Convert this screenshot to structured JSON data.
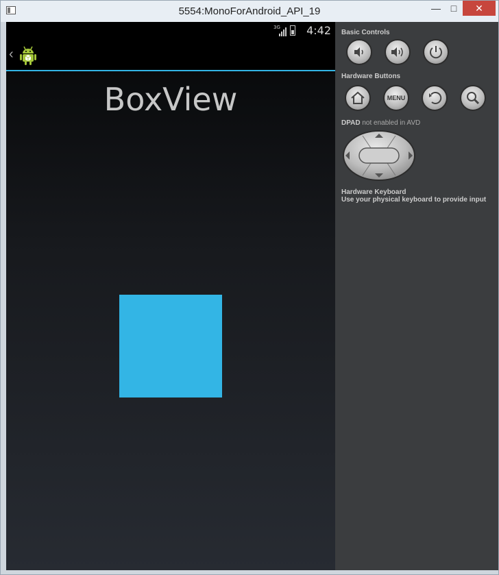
{
  "window": {
    "title": "5554:MonoForAndroid_API_19",
    "controls": [
      "minimize",
      "maximize",
      "close"
    ]
  },
  "status_bar": {
    "network": "3G",
    "time": "4:42"
  },
  "action_bar": {
    "icon": "android-robot-icon"
  },
  "content": {
    "title": "BoxView",
    "box_color": "#33b5e5"
  },
  "emulator_panel": {
    "basic_controls_label": "Basic Controls",
    "hardware_buttons_label": "Hardware Buttons",
    "menu_label": "MENU",
    "dpad_label": "DPAD",
    "dpad_note": "not enabled in AVD",
    "keyboard_label": "Hardware Keyboard",
    "keyboard_note": "Use your physical keyboard to provide input"
  },
  "colors": {
    "accent": "#33b5e5",
    "panel_bg": "#3b3d3f"
  }
}
